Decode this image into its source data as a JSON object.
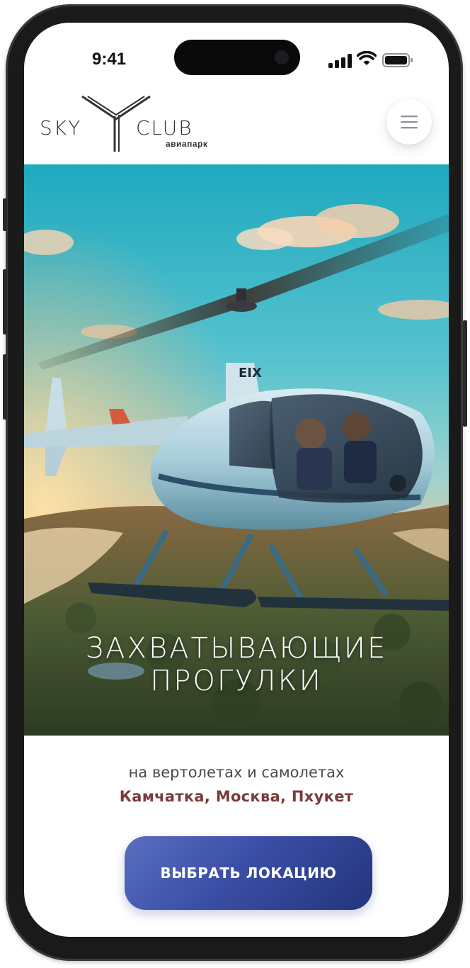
{
  "status_bar": {
    "time": "9:41"
  },
  "header": {
    "logo": {
      "word_left": "SKY",
      "word_right": "CLUB",
      "tagline": "авиапарк"
    },
    "menu_icon": "hamburger-icon"
  },
  "hero": {
    "title_line1": "ЗАХВАТЫВАЮЩИЕ",
    "title_line2": "ПРОГУЛКИ",
    "tail_number": "EIX"
  },
  "subtitle": "на вертолетах и самолетах",
  "locations": "Камчатка, Москва, Пхукет",
  "cta": {
    "label": "ВЫБРАТЬ ЛОКАЦИЮ"
  },
  "colors": {
    "accent": "#3a4ea6",
    "location_text": "#7a3b3b",
    "sky_top": "#2eb3c6",
    "sunset": "#f4a262"
  }
}
